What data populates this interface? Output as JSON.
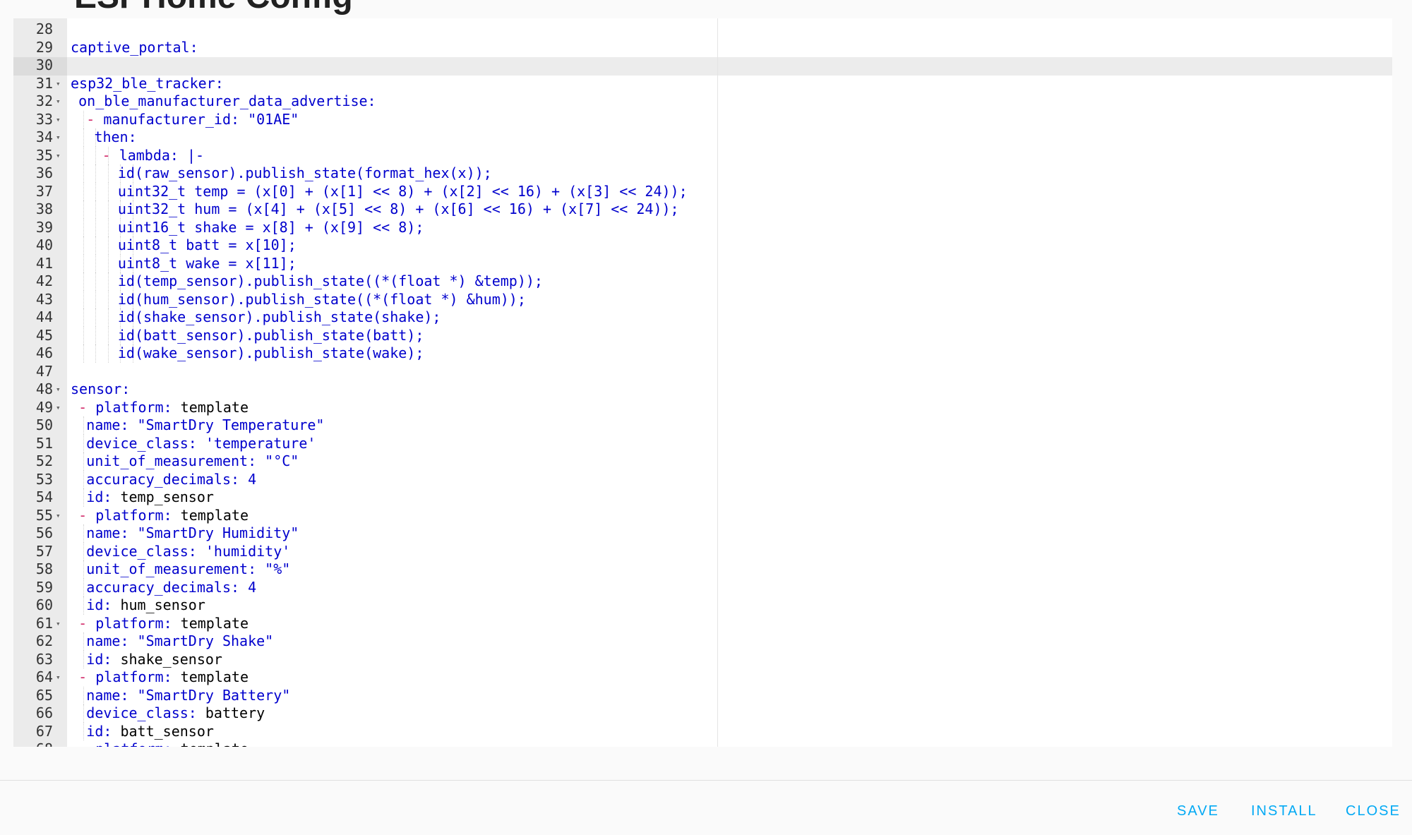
{
  "dialog": {
    "title": "ESPHome Config"
  },
  "editor": {
    "active_line": 30,
    "lines": [
      {
        "n": "28",
        "fold": false,
        "indent": 0,
        "dash": false,
        "key": "",
        "value": "",
        "vtype": "t",
        "text": ""
      },
      {
        "n": "29",
        "fold": false,
        "indent": 0,
        "dash": false,
        "key": "captive_portal:",
        "value": "",
        "vtype": "t"
      },
      {
        "n": "30",
        "fold": false,
        "indent": 0,
        "dash": false,
        "key": "",
        "value": "",
        "vtype": "t"
      },
      {
        "n": "31",
        "fold": true,
        "indent": 0,
        "dash": false,
        "key": "esp32_ble_tracker:",
        "value": "",
        "vtype": "t"
      },
      {
        "n": "32",
        "fold": true,
        "indent": 1,
        "dash": false,
        "key": "on_ble_manufacturer_data_advertise:",
        "value": "",
        "vtype": "t"
      },
      {
        "n": "33",
        "fold": true,
        "indent": 2,
        "dash": true,
        "key": "manufacturer_id: ",
        "value": "\"01AE\"",
        "vtype": "s"
      },
      {
        "n": "34",
        "fold": true,
        "indent": 3,
        "dash": false,
        "key": "then:",
        "value": "",
        "vtype": "t"
      },
      {
        "n": "35",
        "fold": true,
        "indent": 4,
        "dash": true,
        "key": "lambda: |-",
        "value": "",
        "vtype": "t"
      },
      {
        "n": "36",
        "fold": false,
        "indent": 6,
        "dash": false,
        "key": "",
        "value": "id(raw_sensor).publish_state(format_hex(x));",
        "vtype": "s"
      },
      {
        "n": "37",
        "fold": false,
        "indent": 6,
        "dash": false,
        "key": "",
        "value": "uint32_t temp = (x[0] + (x[1] << 8) + (x[2] << 16) + (x[3] << 24));",
        "vtype": "s"
      },
      {
        "n": "38",
        "fold": false,
        "indent": 6,
        "dash": false,
        "key": "",
        "value": "uint32_t hum = (x[4] + (x[5] << 8) + (x[6] << 16) + (x[7] << 24));",
        "vtype": "s"
      },
      {
        "n": "39",
        "fold": false,
        "indent": 6,
        "dash": false,
        "key": "",
        "value": "uint16_t shake = x[8] + (x[9] << 8);",
        "vtype": "s"
      },
      {
        "n": "40",
        "fold": false,
        "indent": 6,
        "dash": false,
        "key": "",
        "value": "uint8_t batt = x[10];",
        "vtype": "s"
      },
      {
        "n": "41",
        "fold": false,
        "indent": 6,
        "dash": false,
        "key": "",
        "value": "uint8_t wake = x[11];",
        "vtype": "s"
      },
      {
        "n": "42",
        "fold": false,
        "indent": 6,
        "dash": false,
        "key": "",
        "value": "id(temp_sensor).publish_state((*(float *) &temp));",
        "vtype": "s"
      },
      {
        "n": "43",
        "fold": false,
        "indent": 6,
        "dash": false,
        "key": "",
        "value": "id(hum_sensor).publish_state((*(float *) &hum));",
        "vtype": "s"
      },
      {
        "n": "44",
        "fold": false,
        "indent": 6,
        "dash": false,
        "key": "",
        "value": "id(shake_sensor).publish_state(shake);",
        "vtype": "s"
      },
      {
        "n": "45",
        "fold": false,
        "indent": 6,
        "dash": false,
        "key": "",
        "value": "id(batt_sensor).publish_state(batt);",
        "vtype": "s"
      },
      {
        "n": "46",
        "fold": false,
        "indent": 6,
        "dash": false,
        "key": "",
        "value": "id(wake_sensor).publish_state(wake);",
        "vtype": "s"
      },
      {
        "n": "47",
        "fold": false,
        "indent": 0,
        "dash": false,
        "key": "",
        "value": "",
        "vtype": "t"
      },
      {
        "n": "48",
        "fold": true,
        "indent": 0,
        "dash": false,
        "key": "sensor:",
        "value": "",
        "vtype": "t"
      },
      {
        "n": "49",
        "fold": true,
        "indent": 1,
        "dash": true,
        "key": "platform: ",
        "value": "template",
        "vtype": "t"
      },
      {
        "n": "50",
        "fold": false,
        "indent": 2,
        "dash": false,
        "key": "name: ",
        "value": "\"SmartDry Temperature\"",
        "vtype": "s"
      },
      {
        "n": "51",
        "fold": false,
        "indent": 2,
        "dash": false,
        "key": "device_class: ",
        "value": "'temperature'",
        "vtype": "s"
      },
      {
        "n": "52",
        "fold": false,
        "indent": 2,
        "dash": false,
        "key": "unit_of_measurement: ",
        "value": "\"°C\"",
        "vtype": "s"
      },
      {
        "n": "53",
        "fold": false,
        "indent": 2,
        "dash": false,
        "key": "accuracy_decimals: ",
        "value": "4",
        "vtype": "s"
      },
      {
        "n": "54",
        "fold": false,
        "indent": 2,
        "dash": false,
        "key": "id: ",
        "value": "temp_sensor",
        "vtype": "t"
      },
      {
        "n": "55",
        "fold": true,
        "indent": 1,
        "dash": true,
        "key": "platform: ",
        "value": "template",
        "vtype": "t"
      },
      {
        "n": "56",
        "fold": false,
        "indent": 2,
        "dash": false,
        "key": "name: ",
        "value": "\"SmartDry Humidity\"",
        "vtype": "s"
      },
      {
        "n": "57",
        "fold": false,
        "indent": 2,
        "dash": false,
        "key": "device_class: ",
        "value": "'humidity'",
        "vtype": "s"
      },
      {
        "n": "58",
        "fold": false,
        "indent": 2,
        "dash": false,
        "key": "unit_of_measurement: ",
        "value": "\"%\"",
        "vtype": "s"
      },
      {
        "n": "59",
        "fold": false,
        "indent": 2,
        "dash": false,
        "key": "accuracy_decimals: ",
        "value": "4",
        "vtype": "s"
      },
      {
        "n": "60",
        "fold": false,
        "indent": 2,
        "dash": false,
        "key": "id: ",
        "value": "hum_sensor",
        "vtype": "t"
      },
      {
        "n": "61",
        "fold": true,
        "indent": 1,
        "dash": true,
        "key": "platform: ",
        "value": "template",
        "vtype": "t"
      },
      {
        "n": "62",
        "fold": false,
        "indent": 2,
        "dash": false,
        "key": "name: ",
        "value": "\"SmartDry Shake\"",
        "vtype": "s"
      },
      {
        "n": "63",
        "fold": false,
        "indent": 2,
        "dash": false,
        "key": "id: ",
        "value": "shake_sensor",
        "vtype": "t"
      },
      {
        "n": "64",
        "fold": true,
        "indent": 1,
        "dash": true,
        "key": "platform: ",
        "value": "template",
        "vtype": "t"
      },
      {
        "n": "65",
        "fold": false,
        "indent": 2,
        "dash": false,
        "key": "name: ",
        "value": "\"SmartDry Battery\"",
        "vtype": "s"
      },
      {
        "n": "66",
        "fold": false,
        "indent": 2,
        "dash": false,
        "key": "device_class: ",
        "value": "battery",
        "vtype": "t"
      },
      {
        "n": "67",
        "fold": false,
        "indent": 2,
        "dash": false,
        "key": "id: ",
        "value": "batt_sensor",
        "vtype": "t"
      },
      {
        "n": "68",
        "fold": false,
        "indent": 1,
        "dash": true,
        "key": "platform: ",
        "value": "template",
        "vtype": "t"
      }
    ]
  },
  "actions": {
    "save_label": "SAVE",
    "install_label": "INSTALL",
    "close_label": "CLOSE"
  },
  "colors": {
    "accent": "#03a9f4",
    "key": "#0000cd",
    "dash": "#d22b6a",
    "gutter": "#ebebeb"
  }
}
